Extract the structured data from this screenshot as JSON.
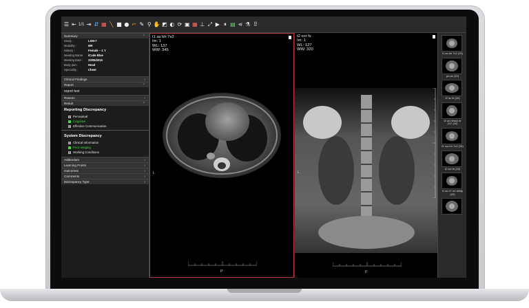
{
  "toolbar": {
    "icons": [
      "menu-icon",
      "prev-series-icon",
      "series-counter",
      "next-series-icon",
      "sync-icon",
      "layout-icon",
      "measure-line-icon",
      "stop-icon",
      "ellipse-icon",
      "angle-icon",
      "eyedropper-icon",
      "zoom-icon",
      "pan-icon",
      "window-level-icon",
      "invert-icon",
      "rotate-icon",
      "image-icon",
      "grid-icon",
      "probe-icon",
      "fullscreen-icon",
      "cine-icon",
      "pause-icon",
      "save-icon",
      "share-icon",
      "annotate-icon",
      "apps-icon"
    ],
    "series_counter": "1/1"
  },
  "panel": {
    "summary_label": "Summary",
    "info": [
      {
        "k": "Study :",
        "v": "LSM-7"
      },
      {
        "k": "Modality :",
        "v": "MR"
      },
      {
        "k": "History :",
        "v": "Female - -1 Y"
      },
      {
        "k": "Meeting Name :",
        "v": "iCode Blue"
      },
      {
        "k": "Meeting Date :",
        "v": "23/05/2015"
      },
      {
        "k": "Body part :",
        "v": "Head"
      },
      {
        "k": "Speciality :",
        "v": "Chest"
      }
    ],
    "clinical_findings": "Clinical Findings",
    "report_label": "Report",
    "report_text": "report test",
    "reason_label": "Reason",
    "result_label": "Result",
    "reporting_discrepancy": {
      "title": "Reporting Discrepancy",
      "items": [
        {
          "label": "Perceptual",
          "active": false
        },
        {
          "label": "Cognitive",
          "active": true
        },
        {
          "label": "Effective Communication",
          "active": false
        }
      ]
    },
    "system_discrepancy": {
      "title": "System Discrepancy",
      "items": [
        {
          "label": "Clinical Information",
          "active": false
        },
        {
          "label": "Poor imaging",
          "active": true
        },
        {
          "label": "Working Conditions",
          "active": false
        }
      ]
    },
    "tail_sections": [
      "Addendum",
      "Learning Points",
      "Outcomes",
      "Comments",
      "Discrepancy Type"
    ]
  },
  "viewport1": {
    "series": "t1 ax bh 7x2",
    "im": "Im: 1",
    "wl": "WL: 137",
    "ww": "WW: 345",
    "left_marker": "L",
    "bottom_marker": "P"
  },
  "viewport2": {
    "series": "t2 cor fs",
    "im": "Im: 1",
    "wl": "WL: 127",
    "ww": "WW: 320",
    "left_marker": "L",
    "bottom_marker": "F"
  },
  "thumbs": [
    {
      "label": "t1 ax bh 7x2 (20)"
    },
    {
      "label": "pd ax (20)"
    },
    {
      "label": "t2 ax fs (16)"
    },
    {
      "label": "t2 ax heavy te 247 (20)"
    },
    {
      "label": "t1 cor bh 7x2 (16)"
    },
    {
      "label": "t2 cor fs (16)"
    },
    {
      "label": "t1 ax c+ no delay (20)"
    },
    {
      "label": ""
    }
  ],
  "colors": {
    "accent_green": "#3fdc3f",
    "active_viewport_border": "#b83a3a",
    "toolbar_bg": "#2b2b2b"
  }
}
